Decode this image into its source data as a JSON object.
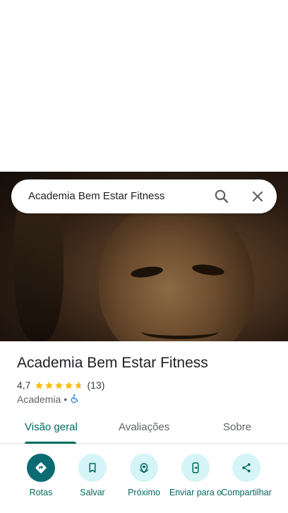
{
  "search": {
    "query": "Academia Bem Estar Fitness"
  },
  "place": {
    "name": "Academia Bem Estar Fitness",
    "rating": "4,7",
    "stars": 4.7,
    "review_count": "(13)",
    "category": "Academia",
    "separator": "•"
  },
  "tabs": [
    {
      "label": "Visão geral"
    },
    {
      "label": "Avaliações"
    },
    {
      "label": "Sobre"
    }
  ],
  "actions": [
    {
      "label": "Rotas",
      "icon": "directions-icon"
    },
    {
      "label": "Salvar",
      "icon": "bookmark-icon"
    },
    {
      "label": "Próximo",
      "icon": "nearby-icon"
    },
    {
      "label": "Enviar para o",
      "icon": "send-to-phone-icon"
    },
    {
      "label": "Compartilhar",
      "icon": "share-icon"
    }
  ],
  "colors": {
    "accent": "#00695c",
    "primary_button": "#0b6b73",
    "button_bg": "#d5f4f7",
    "star": "#fbbc04",
    "accessibility": "#1a73e8"
  }
}
